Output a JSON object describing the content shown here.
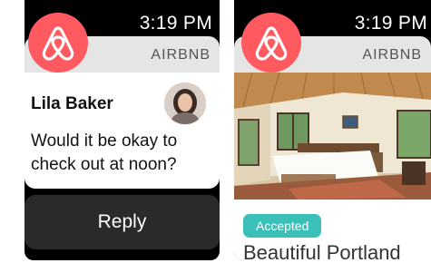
{
  "left_screen": {
    "time": "3:19 PM",
    "app_name": "AIRBNB",
    "sender_name": "Lila Baker",
    "message_line1": "Would it be okay to",
    "message_line2": "check out at noon?",
    "reply_label": "Reply"
  },
  "right_screen": {
    "time": "3:19 PM",
    "app_name": "AIRBNB",
    "status_badge": "Accepted",
    "listing_title": "Beautiful Portland"
  },
  "colors": {
    "brand": "#ff5a5f",
    "badge": "#3bbfb9",
    "reply_button": "#2a2a2a"
  }
}
